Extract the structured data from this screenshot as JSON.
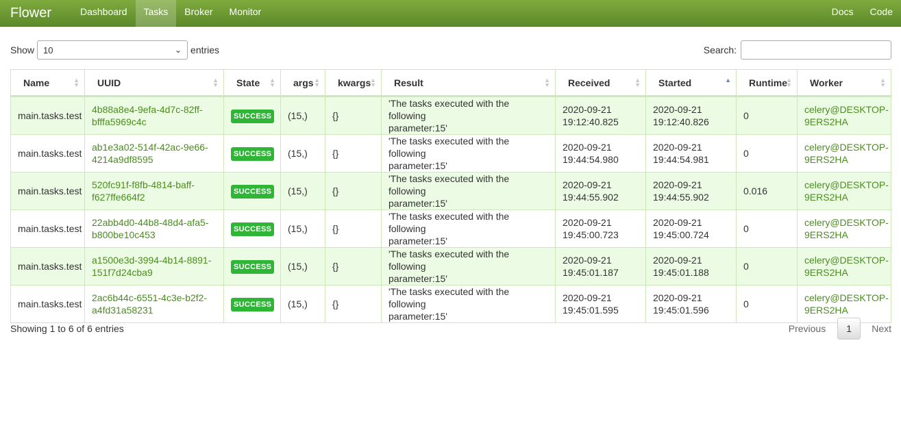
{
  "nav": {
    "brand": "Flower",
    "items": [
      "Dashboard",
      "Tasks",
      "Broker",
      "Monitor"
    ],
    "right": [
      "Docs",
      "Code"
    ]
  },
  "controls": {
    "show_label": "Show",
    "page_size": "10",
    "entries_label": "entries",
    "search_label": "Search:"
  },
  "table": {
    "columns": [
      "Name",
      "UUID",
      "State",
      "args",
      "kwargs",
      "Result",
      "Received",
      "Started",
      "Runtime",
      "Worker"
    ],
    "rows": [
      {
        "name": "main.tasks.test",
        "uuid1": "4b88a8e4-9efa-4d7c-82ff-",
        "uuid2": "bfffa5969c4c",
        "state": "SUCCESS",
        "args": "(15,)",
        "kwargs": "{}",
        "result1": "'The tasks executed with the following",
        "result2": "parameter:15'",
        "received1": "2020-09-21",
        "received2": "19:12:40.825",
        "started1": "2020-09-21",
        "started2": "19:12:40.826",
        "runtime": "0",
        "worker1": "celery@DESKTOP-",
        "worker2": "9ERS2HA"
      },
      {
        "name": "main.tasks.test",
        "uuid1": "ab1e3a02-514f-42ac-9e66-",
        "uuid2": "4214a9df8595",
        "state": "SUCCESS",
        "args": "(15,)",
        "kwargs": "{}",
        "result1": "'The tasks executed with the following",
        "result2": "parameter:15'",
        "received1": "2020-09-21",
        "received2": "19:44:54.980",
        "started1": "2020-09-21",
        "started2": "19:44:54.981",
        "runtime": "0",
        "worker1": "celery@DESKTOP-",
        "worker2": "9ERS2HA"
      },
      {
        "name": "main.tasks.test",
        "uuid1": "520fc91f-f8fb-4814-baff-",
        "uuid2": "f627ffe664f2",
        "state": "SUCCESS",
        "args": "(15,)",
        "kwargs": "{}",
        "result1": "'The tasks executed with the following",
        "result2": "parameter:15'",
        "received1": "2020-09-21",
        "received2": "19:44:55.902",
        "started1": "2020-09-21",
        "started2": "19:44:55.902",
        "runtime": "0.016",
        "worker1": "celery@DESKTOP-",
        "worker2": "9ERS2HA"
      },
      {
        "name": "main.tasks.test",
        "uuid1": "22abb4d0-44b8-48d4-afa5-",
        "uuid2": "b800be10c453",
        "state": "SUCCESS",
        "args": "(15,)",
        "kwargs": "{}",
        "result1": "'The tasks executed with the following",
        "result2": "parameter:15'",
        "received1": "2020-09-21",
        "received2": "19:45:00.723",
        "started1": "2020-09-21",
        "started2": "19:45:00.724",
        "runtime": "0",
        "worker1": "celery@DESKTOP-",
        "worker2": "9ERS2HA"
      },
      {
        "name": "main.tasks.test",
        "uuid1": "a1500e3d-3994-4b14-8891-",
        "uuid2": "151f7d24cba9",
        "state": "SUCCESS",
        "args": "(15,)",
        "kwargs": "{}",
        "result1": "'The tasks executed with the following",
        "result2": "parameter:15'",
        "received1": "2020-09-21",
        "received2": "19:45:01.187",
        "started1": "2020-09-21",
        "started2": "19:45:01.188",
        "runtime": "0",
        "worker1": "celery@DESKTOP-",
        "worker2": "9ERS2HA"
      },
      {
        "name": "main.tasks.test",
        "uuid1": "2ac6b44c-6551-4c3e-b2f2-",
        "uuid2": "a4fd31a58231",
        "state": "SUCCESS",
        "args": "(15,)",
        "kwargs": "{}",
        "result1": "'The tasks executed with the following",
        "result2": "parameter:15'",
        "received1": "2020-09-21",
        "received2": "19:45:01.595",
        "started1": "2020-09-21",
        "started2": "19:45:01.596",
        "runtime": "0",
        "worker1": "celery@DESKTOP-",
        "worker2": "9ERS2HA"
      }
    ]
  },
  "footer": {
    "info": "Showing 1 to 6 of 6 entries",
    "previous": "Previous",
    "current_page": "1",
    "next": "Next"
  },
  "colors": {
    "navbar": "#6b9a33",
    "link": "#4a8d1e",
    "badge": "#2fb637",
    "row_alt": "#ecfbe3"
  }
}
